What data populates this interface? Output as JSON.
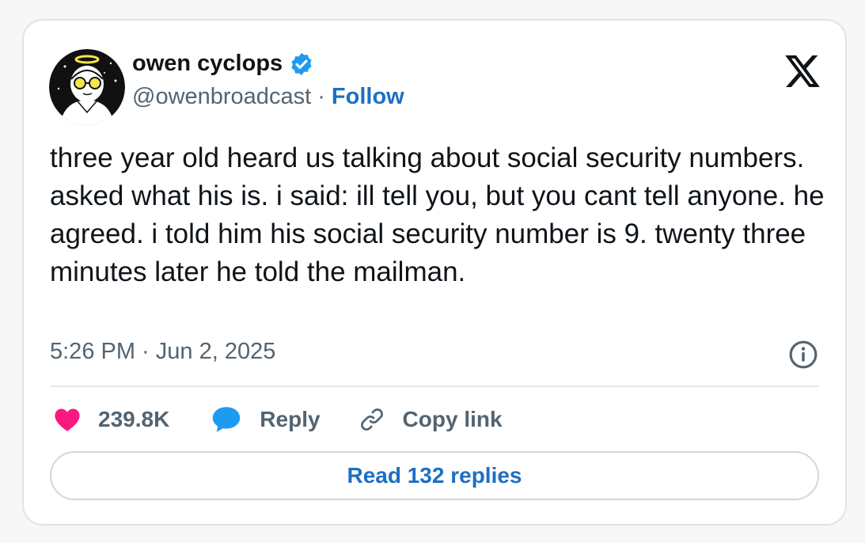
{
  "author": {
    "name": "owen cyclops",
    "handle": "@owenbroadcast",
    "separator": "·",
    "follow_label": "Follow"
  },
  "tweet": {
    "text": "three year old heard us talking about social security numbers. asked what his is. i said: ill tell you, but you cant tell anyone. he agreed. i told him his social security number is 9. twenty three minutes later he told the mailman.",
    "timestamp": "5:26 PM · Jun 2, 2025"
  },
  "actions": {
    "like_count": "239.8K",
    "reply_label": "Reply",
    "copy_link_label": "Copy link"
  },
  "read_replies_label": "Read 132 replies",
  "icons": {
    "logo": "x-logo-icon",
    "verified": "verified-badge-icon",
    "info": "info-icon",
    "like": "heart-icon",
    "reply": "speech-bubble-icon",
    "copy": "link-icon"
  },
  "colors": {
    "accent": "#1d6fc4",
    "verified": "#1d9bf0",
    "heart": "#f91880",
    "text_primary": "#0f1419",
    "text_secondary": "#536471"
  }
}
